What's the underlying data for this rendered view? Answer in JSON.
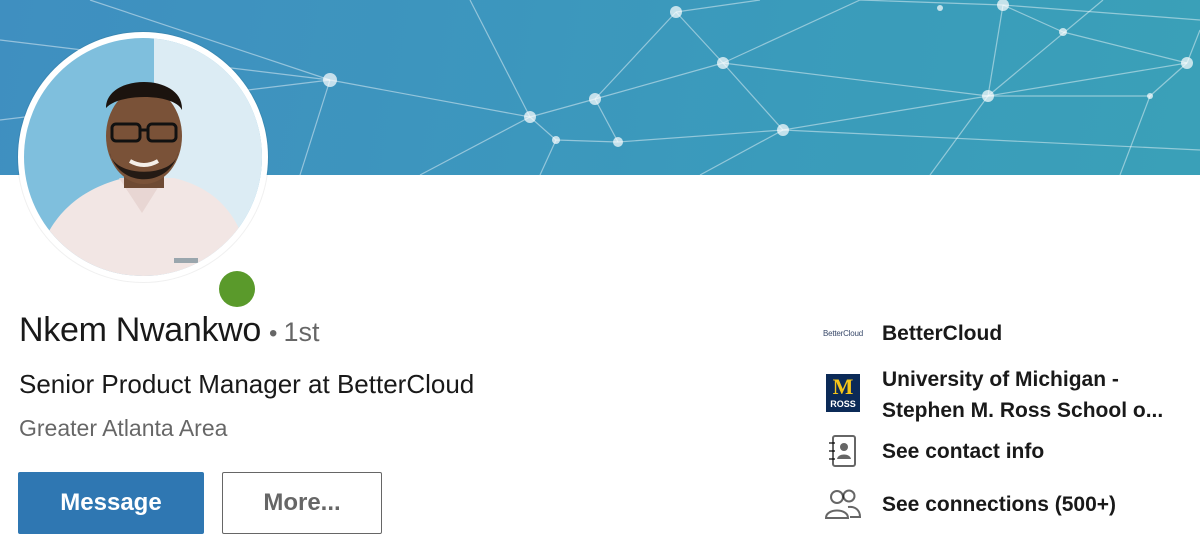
{
  "profile": {
    "name": "Nkem Nwankwo",
    "separator": "•",
    "degree": "1st",
    "headline": "Senior Product Manager at BetterCloud",
    "location": "Greater Atlanta Area",
    "online": true
  },
  "actions": {
    "message_label": "Message",
    "more_label": "More..."
  },
  "sidebar": {
    "items": [
      {
        "label_lines": [
          "BetterCloud"
        ],
        "icon": "bettercloud-logo",
        "logo_text": "BetterCloud"
      },
      {
        "label_lines": [
          "University of Michigan -",
          "Stephen M. Ross School o..."
        ],
        "icon": "michigan-ross-logo",
        "logo_text": [
          "M",
          "ROSS"
        ]
      },
      {
        "label_lines": [
          "See contact info"
        ],
        "icon": "address-book-icon"
      },
      {
        "label_lines": [
          "See connections (500+)"
        ],
        "icon": "people-icon"
      }
    ]
  },
  "colors": {
    "banner": "#3d95be",
    "primary_button": "#2f77b2",
    "presence": "#5a9a2b"
  }
}
